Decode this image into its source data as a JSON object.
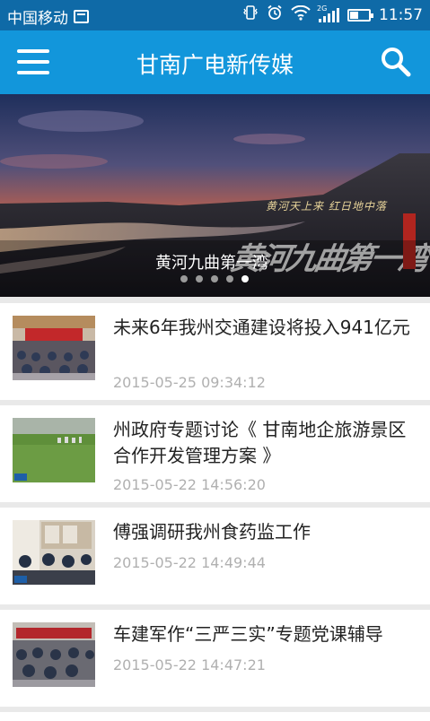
{
  "status_bar": {
    "carrier": "中国移动",
    "network": "2G",
    "time": "11:57"
  },
  "app_bar": {
    "title": "甘南广电新传媒"
  },
  "banner": {
    "caption": "黄河九曲第一湾",
    "overlay_small_text": "黄河天上来  红日地中落",
    "overlay_big_text": "黄河九曲第一湾",
    "dots_total": 5,
    "active_dot_index": 4
  },
  "news": [
    {
      "title": "未来6年我州交通建设将投入941亿元",
      "date": "2015-05-25 09:34:12"
    },
    {
      "title": "州政府专题讨论《 甘南地企旅游景区合作开发管理方案 》",
      "date": "2015-05-22 14:56:20"
    },
    {
      "title": "傅强调研我州食药监工作",
      "date": "2015-05-22 14:49:44"
    },
    {
      "title": "车建军作“三严三实”专题党课辅导",
      "date": "2015-05-22 14:47:21"
    }
  ],
  "colors": {
    "status_bar": "#0f6aa7",
    "app_bar": "#1296db",
    "date_text": "#b0b0b0"
  }
}
